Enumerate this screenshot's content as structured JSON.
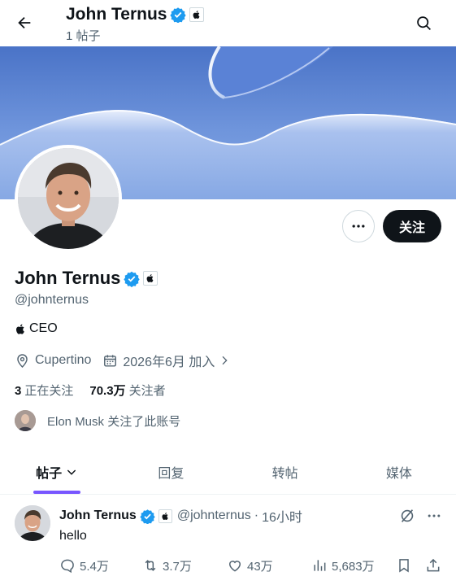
{
  "header": {
    "title": "John Ternus",
    "post_count": "1 帖子"
  },
  "profile": {
    "name": "John Ternus",
    "handle": "@johnternus",
    "bio": "CEO",
    "location": "Cupertino",
    "joined": "2026年6月 加入",
    "following_count": "3",
    "following_label": "正在关注",
    "followers_count": "70.3万",
    "followers_label": "关注者",
    "followed_by": "Elon Musk 关注了此账号",
    "follow_button": "关注"
  },
  "tabs": [
    {
      "label": "帖子",
      "active": true
    },
    {
      "label": "回复",
      "active": false
    },
    {
      "label": "转帖",
      "active": false
    },
    {
      "label": "媒体",
      "active": false
    }
  ],
  "post": {
    "author": "John Ternus",
    "handle": "@johnternus",
    "separator": "·",
    "time": "16小时",
    "text": "hello",
    "replies": "5.4万",
    "reposts": "3.7万",
    "likes": "43万",
    "views": "5,683万"
  },
  "colors": {
    "accent": "#7856ff",
    "verified": "#1d9bf0",
    "text_primary": "#0f1419",
    "text_secondary": "#536471",
    "follow_button_bg": "#0f1419"
  },
  "icons": {
    "back": "arrow-left-icon",
    "search": "search-icon",
    "verified": "verified-badge-icon",
    "affiliation": "apple-logo-icon",
    "more": "more-horizontal-icon",
    "location": "location-pin-icon",
    "calendar": "calendar-icon",
    "reply": "reply-icon",
    "repost": "repost-icon",
    "like": "like-icon",
    "views": "views-icon",
    "bookmark": "bookmark-icon",
    "share": "share-icon",
    "grok": "grok-icon"
  }
}
